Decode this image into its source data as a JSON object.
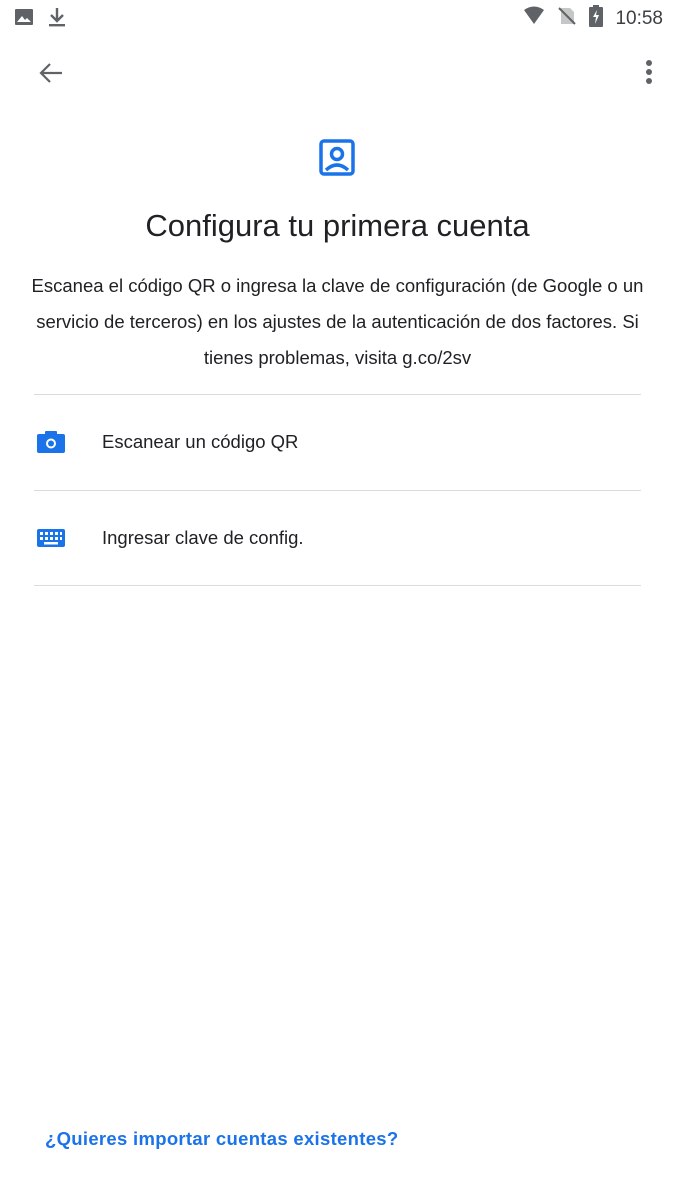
{
  "colors": {
    "accent": "#1a73e8",
    "text": "#202124",
    "divider": "#dadce0",
    "status_icon": "#5f6368"
  },
  "status_bar": {
    "time": "10:58",
    "left_icons": [
      "image-icon",
      "download-icon"
    ],
    "right_icons": [
      "wifi-icon",
      "no-sim-icon",
      "battery-charging-icon"
    ]
  },
  "toolbar": {
    "back_icon": "arrow-back-icon",
    "menu_icon": "more-vert-icon"
  },
  "header": {
    "icon": "account-box-icon",
    "title": "Configura tu primera cuenta",
    "description": "Escanea el código QR o ingresa la clave de configuración (de Google o un servicio de terceros) en los ajustes de la autenticación de dos factores. Si tienes problemas, visita g.co/2sv"
  },
  "options": [
    {
      "icon": "camera-icon",
      "label": "Escanear un código QR"
    },
    {
      "icon": "keyboard-icon",
      "label": "Ingresar clave de config."
    }
  ],
  "footer": {
    "import_link": "¿Quieres importar cuentas existentes?"
  }
}
